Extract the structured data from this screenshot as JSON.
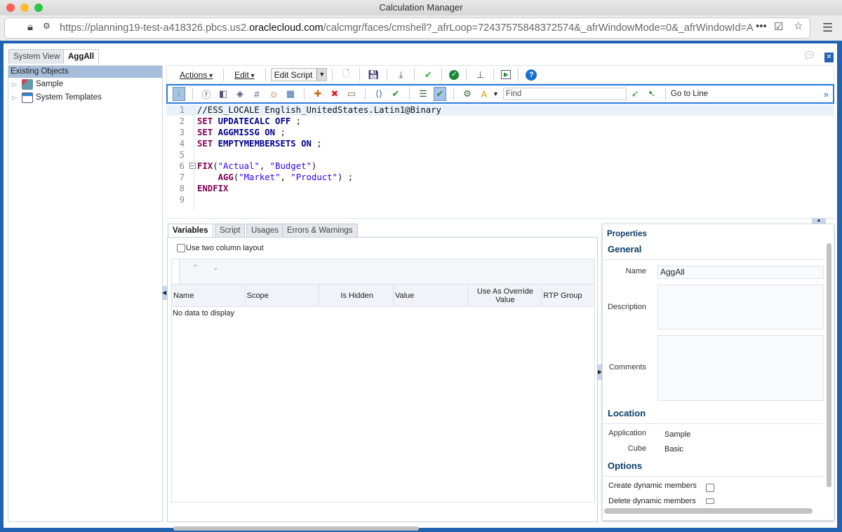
{
  "window": {
    "title": "Calculation Manager",
    "url_prefix": "https://planning19-test-a418326.pbcs.us2.",
    "url_domain": "oraclecloud.com",
    "url_suffix": "/calcmgr/faces/cmshell?_afrLoop=72437575848372574&_afrWindowMode=0&_afrWindowId=A"
  },
  "panel_tabs": [
    {
      "label": "System View"
    },
    {
      "label": "AggAll"
    }
  ],
  "left_panel": {
    "header": "Existing Objects",
    "items": [
      {
        "label": "Sample"
      },
      {
        "label": "System Templates"
      }
    ]
  },
  "toolbar": {
    "actions": "Actions",
    "edit": "Edit",
    "mode": "Edit Script",
    "find_placeholder": "Find",
    "goto_line": "Go to Line",
    "more": "»",
    "icons1": [
      "new-icon",
      "save-icon",
      "export-icon",
      "save-validate-icon",
      "validate-icon",
      "deploy-icon",
      "launch-icon",
      "help-icon"
    ],
    "icons2": [
      "line-numbers-icon",
      "function-icon",
      "member-icon",
      "member-range-icon",
      "variable-icon",
      "user-icon",
      "smart-list-icon",
      "add-comment-icon",
      "remove-comment-icon",
      "comment-icon",
      "braces-icon",
      "syntax-check-icon",
      "format-icon",
      "rule-validate-icon",
      "debug-icon",
      "highlight-icon"
    ]
  },
  "editor": {
    "lines": [
      [
        {
          "t": "txt",
          "v": "//ESS_LOCALE English_UnitedStates.Latin1@Binary"
        }
      ],
      [
        {
          "t": "kw",
          "v": "SET"
        },
        {
          "t": "txt",
          "v": " "
        },
        {
          "t": "id",
          "v": "UPDATECALC OFF"
        },
        {
          "t": "txt",
          "v": " ;"
        }
      ],
      [
        {
          "t": "kw",
          "v": "SET"
        },
        {
          "t": "txt",
          "v": " "
        },
        {
          "t": "id",
          "v": "AGGMISSG ON"
        },
        {
          "t": "txt",
          "v": " ;"
        }
      ],
      [
        {
          "t": "kw",
          "v": "SET"
        },
        {
          "t": "txt",
          "v": " "
        },
        {
          "t": "id",
          "v": "EMPTYMEMBERSETS ON"
        },
        {
          "t": "txt",
          "v": " ;"
        }
      ],
      [],
      [
        {
          "t": "kw",
          "v": "FIX"
        },
        {
          "t": "txt",
          "v": "("
        },
        {
          "t": "str",
          "v": "\"Actual\""
        },
        {
          "t": "txt",
          "v": ", "
        },
        {
          "t": "str",
          "v": "\"Budget\""
        },
        {
          "t": "txt",
          "v": ")"
        }
      ],
      [
        {
          "t": "txt",
          "v": "    "
        },
        {
          "t": "kw",
          "v": "AGG"
        },
        {
          "t": "txt",
          "v": "("
        },
        {
          "t": "str",
          "v": "\"Market\""
        },
        {
          "t": "txt",
          "v": ", "
        },
        {
          "t": "str",
          "v": "\"Product\""
        },
        {
          "t": "txt",
          "v": ") ;"
        }
      ],
      [
        {
          "t": "kw",
          "v": "ENDFIX"
        }
      ],
      []
    ]
  },
  "bottom_tabs": [
    {
      "label": "Variables"
    },
    {
      "label": "Script"
    },
    {
      "label": "Usages"
    },
    {
      "label": "Errors & Warnings"
    }
  ],
  "variables": {
    "two_column_label": "Use two column layout",
    "columns": [
      "Name",
      "Scope",
      "Is Hidden",
      "Value",
      "Use As Override Value",
      "RTP Group"
    ],
    "empty": "No data to display"
  },
  "properties": {
    "title": "Properties",
    "general": "General",
    "name_label": "Name",
    "name_value": "AggAll",
    "description_label": "Description",
    "comments_label": "Comments",
    "location": "Location",
    "application_label": "Application",
    "application_value": "Sample",
    "cube_label": "Cube",
    "cube_value": "Basic",
    "options": "Options",
    "create_dynamic": "Create dynamic members",
    "delete_dynamic": "Delete dynamic members"
  }
}
